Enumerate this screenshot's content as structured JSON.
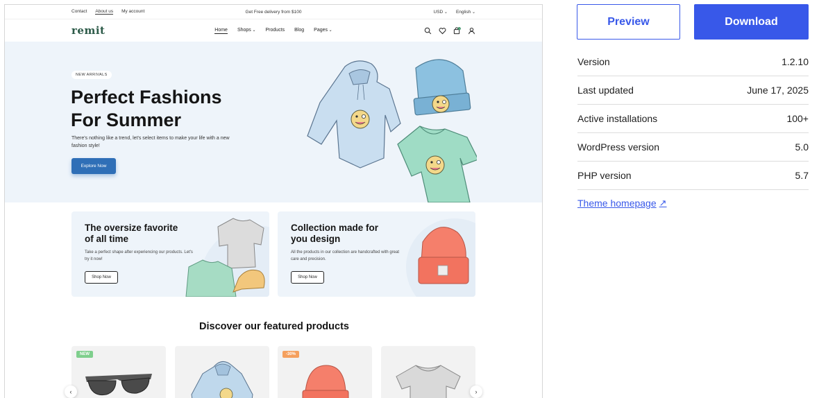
{
  "preview": {
    "topbar": {
      "links": [
        "Contact",
        "About us",
        "My account"
      ],
      "promo": "Get Free delivery from $100",
      "currency": "USD",
      "language": "English"
    },
    "nav": {
      "logo": "remit",
      "menu": [
        "Home",
        "Shops",
        "Products",
        "Blog",
        "Pages"
      ],
      "cart_count": "0"
    },
    "hero": {
      "badge": "NEW ARRIVALS",
      "title_line1": "Perfect Fashions",
      "title_line2": "For Summer",
      "subtitle": "There's nothing like a trend, let's select items to make your life with a new fashion style!",
      "button": "Explore Now"
    },
    "promos": [
      {
        "title_line1": "The oversize favorite",
        "title_line2": "of all time",
        "text": "Take a perfect shape after experiencing our products. Let's try it now!",
        "button": "Shop Now"
      },
      {
        "title_line1": "Collection made for",
        "title_line2": "you design",
        "text": "All the products in our collection are handcrafted with great care and precision.",
        "button": "Shop Now"
      }
    ],
    "featured": {
      "title": "Discover our featured products",
      "badges": [
        "NEW",
        "-30%"
      ],
      "prev_arrow": "‹",
      "next_arrow": "›"
    }
  },
  "actions": {
    "preview_label": "Preview",
    "download_label": "Download"
  },
  "meta": [
    {
      "label": "Version",
      "value": "1.2.10"
    },
    {
      "label": "Last updated",
      "value": "June 17, 2025"
    },
    {
      "label": "Active installations",
      "value": "100+"
    },
    {
      "label": "WordPress version",
      "value": "5.0"
    },
    {
      "label": "PHP version",
      "value": "5.7"
    }
  ],
  "theme_link": {
    "label": "Theme homepage",
    "icon": "↗"
  },
  "colors": {
    "accent": "#3858e9",
    "hero_bg": "#eef4fa",
    "hero_button": "#2f6fb7"
  }
}
